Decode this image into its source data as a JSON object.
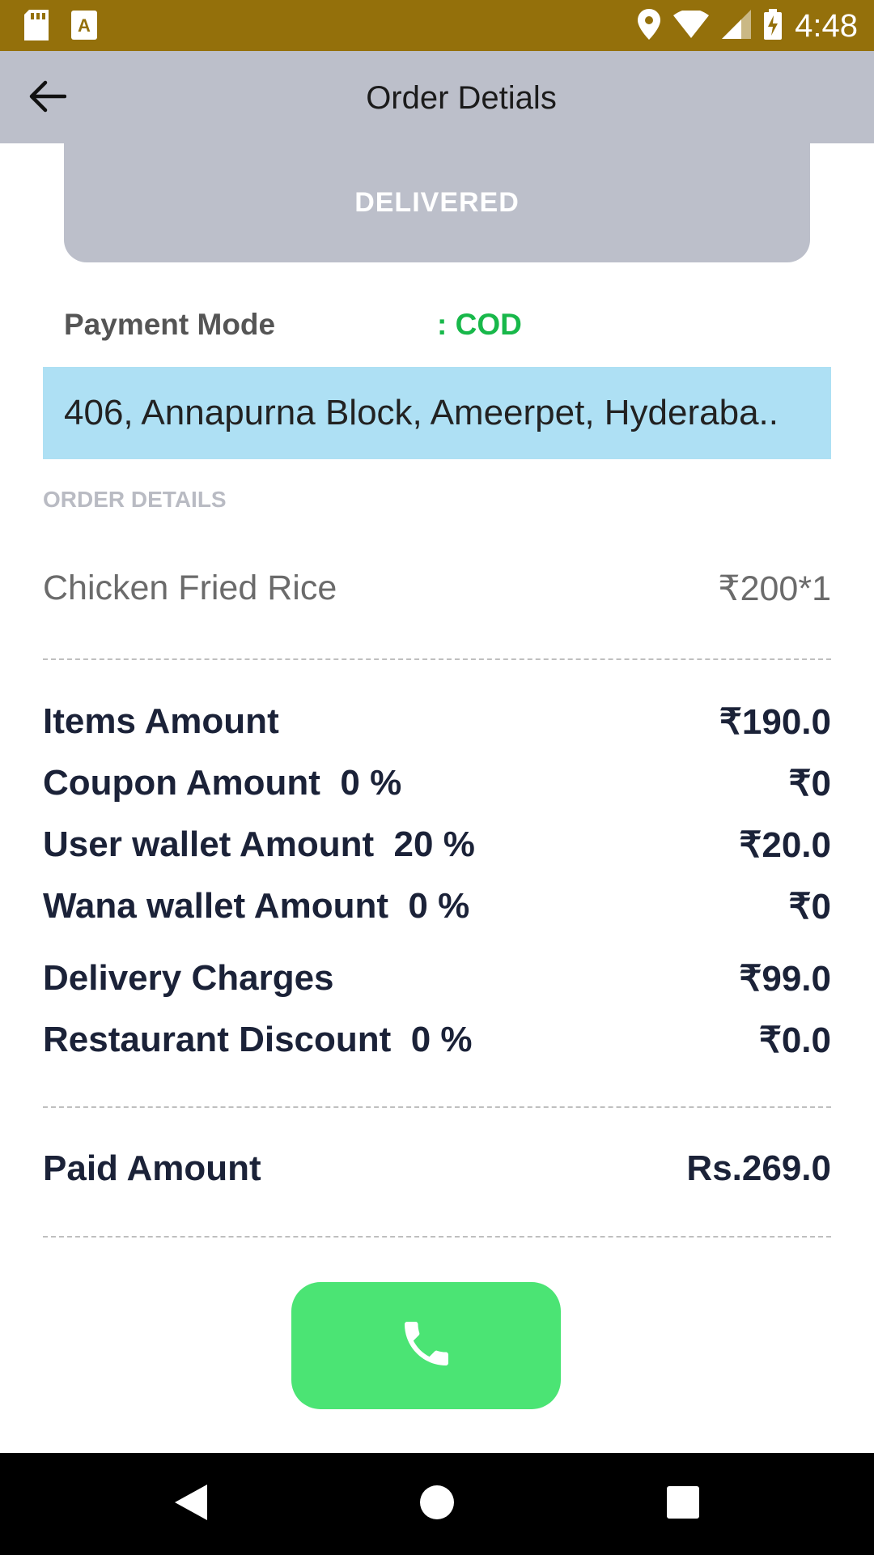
{
  "status_bar": {
    "time": "4:48",
    "icons": [
      "sd-card-icon",
      "accessibility-icon",
      "location-icon",
      "wifi-icon",
      "signal-icon",
      "battery-charging-icon"
    ]
  },
  "header": {
    "title": "Order Detials"
  },
  "order": {
    "status": "DELIVERED",
    "payment_label": "Payment Mode",
    "payment_value": ": COD",
    "address": "406, Annapurna Block, Ameerpet, Hyderaba..",
    "section_label": "ORDER DETAILS",
    "items": [
      {
        "name": "Chicken Fried Rice",
        "price": "₹200*1"
      }
    ]
  },
  "summary": [
    {
      "label": "Items Amount",
      "value": "₹190.0"
    },
    {
      "label": "Coupon Amount  0 %",
      "value": "₹0"
    },
    {
      "label": "User wallet Amount  20 %",
      "value": "₹20.0"
    },
    {
      "label": "Wana wallet Amount  0 %",
      "value": "₹0"
    },
    {
      "label": "Delivery Charges",
      "value": "₹99.0"
    },
    {
      "label": "Restaurant Discount  0 %",
      "value": "₹0.0"
    }
  ],
  "paid": {
    "label": "Paid Amount",
    "value": "Rs.269.0"
  },
  "colors": {
    "status_bar": "#94700b",
    "app_bar": "#bcbfca",
    "address_bg": "#aee0f4",
    "call_button": "#4be474",
    "cod_green": "#18b84a"
  },
  "call_button_icon": "phone-icon",
  "nav_icons": [
    "back-icon",
    "home-icon",
    "recents-icon"
  ]
}
